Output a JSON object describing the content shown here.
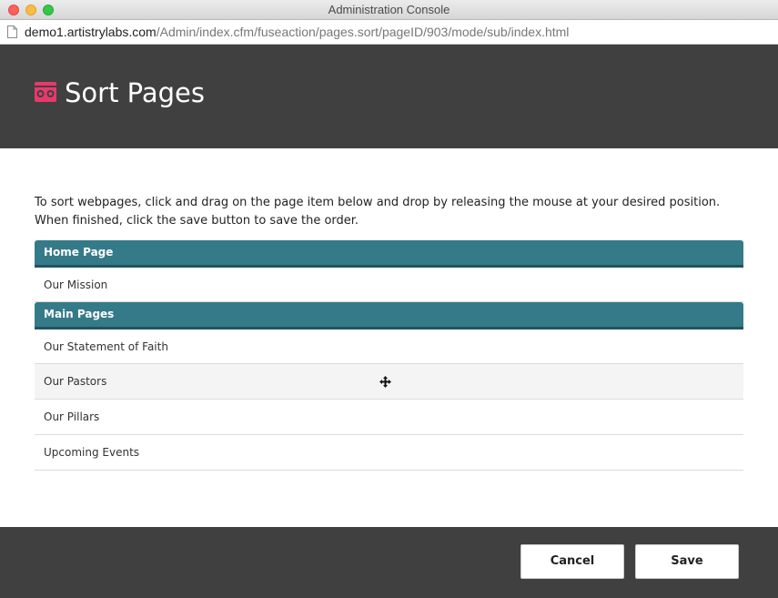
{
  "window": {
    "title": "Administration Console"
  },
  "address_bar": {
    "host": "demo1.artistrylabs.com",
    "path": "/Admin/index.cfm/fuseaction/pages.sort/pageID/903/mode/sub/index.html"
  },
  "header": {
    "title": "Sort Pages",
    "icon": "glasses-logo-icon",
    "accent_color": "#e8396b"
  },
  "instructions": "To sort webpages, click and drag on the page item below and drop by releasing the mouse at your desired position. When finished, click the save button to save the order.",
  "groups": [
    {
      "label": "Home Page",
      "items": [
        "Our Mission"
      ]
    },
    {
      "label": "Main Pages",
      "items": [
        "Our Statement of Faith",
        "Our Pastors",
        "Our Pillars",
        "Upcoming Events"
      ]
    }
  ],
  "footer": {
    "cancel_label": "Cancel",
    "save_label": "Save"
  },
  "colors": {
    "header_bg": "#404040",
    "group_header_bg": "#347a89"
  }
}
